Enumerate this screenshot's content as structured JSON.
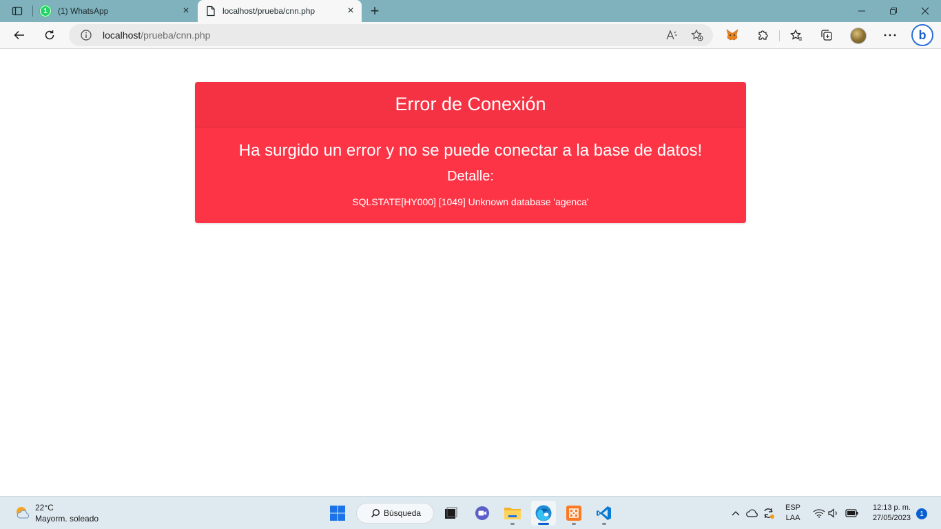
{
  "browser": {
    "tabs": [
      {
        "label": "(1) WhatsApp",
        "badge": "1"
      },
      {
        "label": "localhost/prueba/cnn.php"
      }
    ],
    "close_glyph": "×",
    "new_tab_glyph": "+",
    "window_controls": {
      "minimize": "—",
      "restore": "❐",
      "close": "✕"
    }
  },
  "address_bar": {
    "host": "localhost",
    "path": "/prueba/cnn.php"
  },
  "page": {
    "card_header": "Error de Conexión",
    "card_title": "Ha surgido un error y no se puede conectar a la base de datos!",
    "card_subtitle": "Detalle:",
    "card_detail": "SQLSTATE[HY000] [1049] Unknown database 'agenca'",
    "card_color": "#fd3446"
  },
  "taskbar": {
    "weather": {
      "temp": "22°C",
      "desc": "Mayorm. soleado"
    },
    "search_label": "Búsqueda",
    "lang_top": "ESP",
    "lang_bottom": "LAA",
    "time": "12:13 p. m.",
    "date": "27/05/2023",
    "notification_count": "1"
  }
}
